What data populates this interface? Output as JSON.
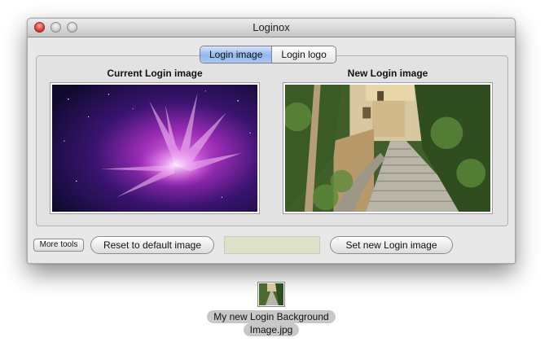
{
  "window": {
    "title": "Loginox"
  },
  "tabs": [
    {
      "label": "Login image",
      "active": true
    },
    {
      "label": "Login logo",
      "active": false
    }
  ],
  "panels": {
    "current_heading": "Current Login image",
    "new_heading": "New Login image"
  },
  "buttons": {
    "more_tools": "More tools",
    "reset": "Reset to default image",
    "set_new": "Set new Login image"
  },
  "drop_field": {
    "value": ""
  },
  "desktop_file": {
    "name_line1": "My new Login Background",
    "name_line2": "Image.jpg"
  },
  "colors": {
    "accent_tab": "#8fb7ee",
    "close_button": "#e0443a",
    "drop_field": "#dde1c8"
  }
}
